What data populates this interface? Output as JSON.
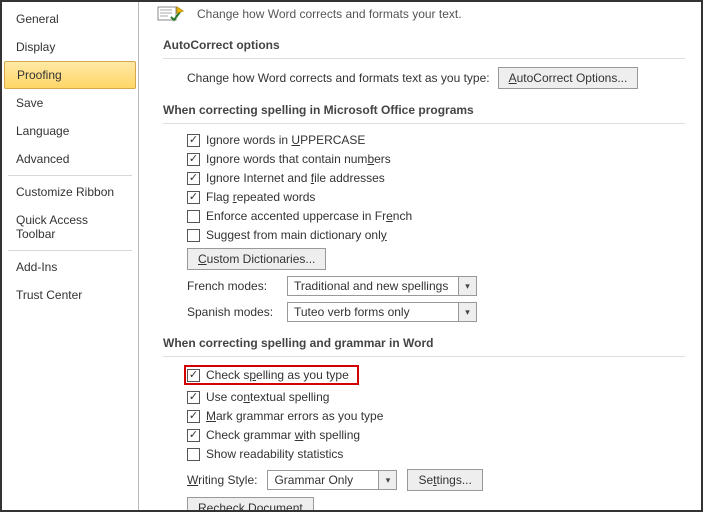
{
  "sidebar": {
    "items": [
      {
        "label": "General"
      },
      {
        "label": "Display"
      },
      {
        "label": "Proofing"
      },
      {
        "label": "Save"
      },
      {
        "label": "Language"
      },
      {
        "label": "Advanced"
      },
      {
        "label": "Customize Ribbon"
      },
      {
        "label": "Quick Access Toolbar"
      },
      {
        "label": "Add-Ins"
      },
      {
        "label": "Trust Center"
      }
    ],
    "selected_index": 2
  },
  "header_text": "Change how Word corrects and formats your text.",
  "sections": {
    "autocorrect": {
      "title": "AutoCorrect options",
      "desc": "Change how Word corrects and formats text as you type:",
      "button": "AutoCorrect Options..."
    },
    "office": {
      "title": "When correcting spelling in Microsoft Office programs",
      "checks": [
        {
          "label_pre": "Ignore words in ",
          "u": "U",
          "label_post": "PPERCASE",
          "checked": true
        },
        {
          "label_pre": "Ignore words that contain num",
          "u": "b",
          "label_post": "ers",
          "checked": true
        },
        {
          "label_pre": "Ignore Internet and ",
          "u": "f",
          "label_post": "ile addresses",
          "checked": true
        },
        {
          "label_pre": "Flag ",
          "u": "r",
          "label_post": "epeated words",
          "checked": true
        },
        {
          "label_pre": "Enforce accented uppercase in Fr",
          "u": "e",
          "label_post": "nch",
          "checked": false
        },
        {
          "label_pre": "Suggest from main dictionary onl",
          "u": "y",
          "label_post": "",
          "checked": false
        }
      ],
      "custom_btn_pre": "",
      "custom_btn_u": "C",
      "custom_btn_post": "ustom Dictionaries...",
      "french_label": "French modes:",
      "french_value": "Traditional and new spellings",
      "spanish_label": "Spanish modes:",
      "spanish_value": "Tuteo verb forms only"
    },
    "word": {
      "title": "When correcting spelling and grammar in Word",
      "checks": [
        {
          "label_pre": "Check s",
          "u": "p",
          "label_post": "elling as you type",
          "checked": true,
          "highlight": true
        },
        {
          "label_pre": "Use co",
          "u": "n",
          "label_post": "textual spelling",
          "checked": true
        },
        {
          "label_pre": "",
          "u": "M",
          "label_post": "ark grammar errors as you type",
          "checked": true
        },
        {
          "label_pre": "Check grammar ",
          "u": "w",
          "label_post": "ith spelling",
          "checked": true
        },
        {
          "label_pre": "Show readability statistics",
          "u": "",
          "label_post": "",
          "checked": false
        }
      ],
      "style_label_pre": "",
      "style_label_u": "W",
      "style_label_post": "riting Style:",
      "style_value": "Grammar Only",
      "settings_btn": "Settings...",
      "recheck_btn": "Recheck Document"
    }
  }
}
